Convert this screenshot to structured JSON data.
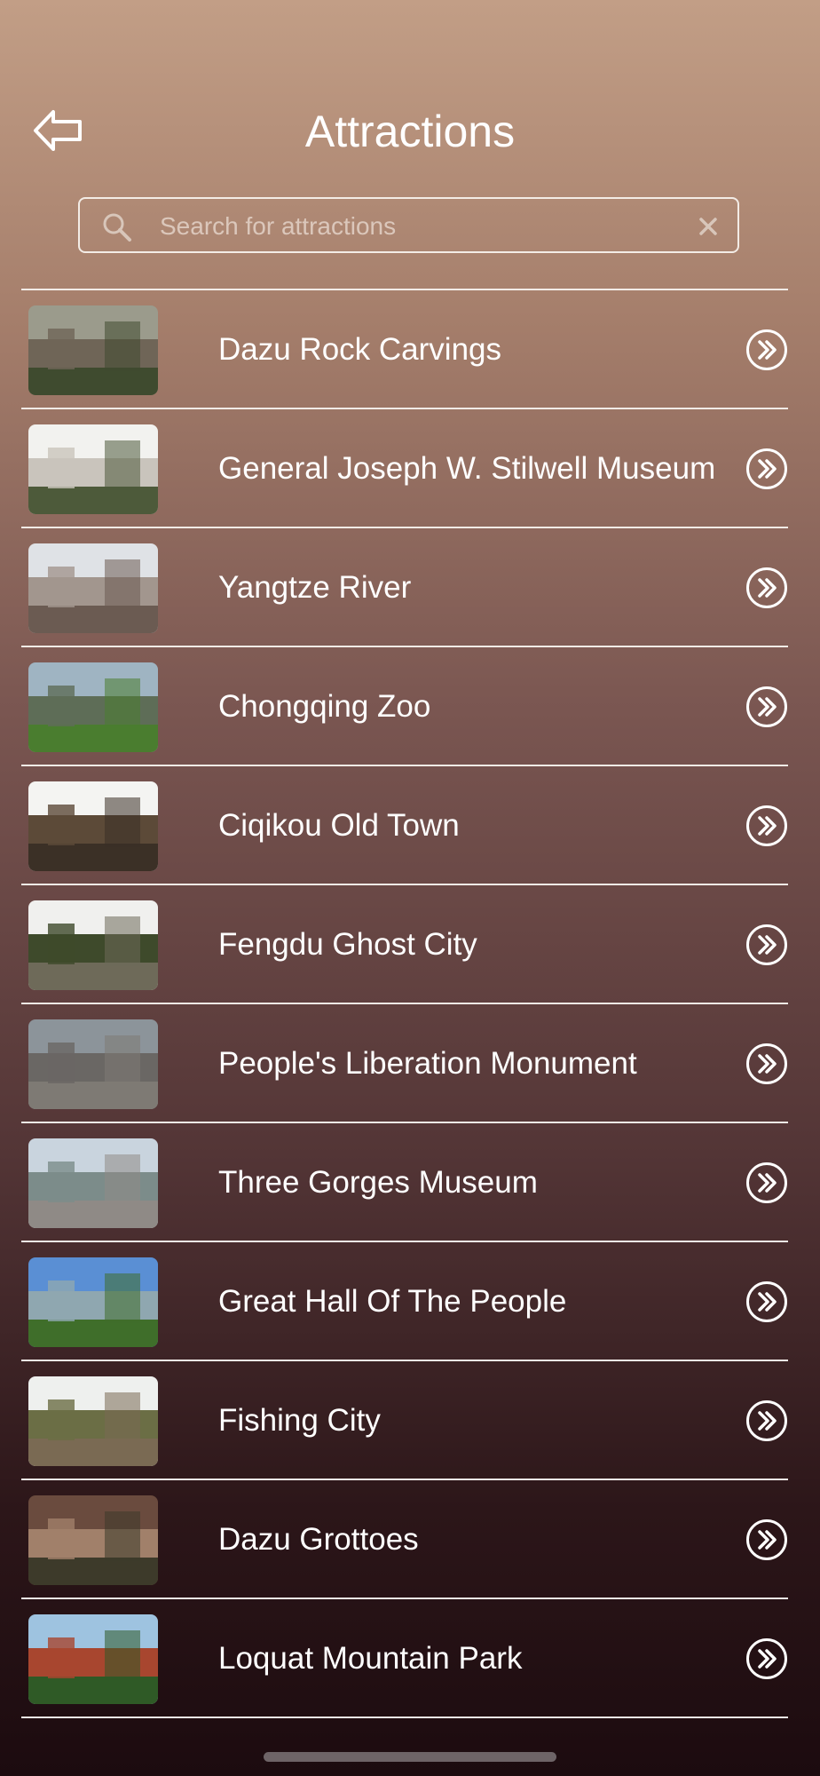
{
  "header": {
    "title": "Attractions",
    "back_icon": "arrow-left-icon"
  },
  "search": {
    "placeholder": "Search for attractions",
    "value": "",
    "icon": "search-icon",
    "clear_icon": "close-icon"
  },
  "attractions": [
    {
      "name": "Dazu Rock Carvings",
      "thumb": "dazu-rock-carvings-thumbnail",
      "theme": [
        "#9b9b8c",
        "#6f6557",
        "#3f4b2f"
      ]
    },
    {
      "name": "General Joseph W. Stilwell Museum",
      "thumb": "stilwell-museum-thumbnail",
      "theme": [
        "#f2f2ef",
        "#c9c4bc",
        "#4d5a3a"
      ]
    },
    {
      "name": "Yangtze River",
      "thumb": "yangtze-river-thumbnail",
      "theme": [
        "#dfe2e6",
        "#a2968e",
        "#6b5b52"
      ]
    },
    {
      "name": "Chongqing Zoo",
      "thumb": "chongqing-zoo-thumbnail",
      "theme": [
        "#9fb4c2",
        "#5e6d57",
        "#4a7d2f"
      ]
    },
    {
      "name": "Ciqikou Old Town",
      "thumb": "ciqikou-old-town-thumbnail",
      "theme": [
        "#f4f4f2",
        "#5c4a38",
        "#3b3026"
      ]
    },
    {
      "name": "Fengdu Ghost City",
      "thumb": "fengdu-ghost-city-thumbnail",
      "theme": [
        "#f0f0ee",
        "#3e4a2b",
        "#6e6a59"
      ]
    },
    {
      "name": "People's Liberation Monument",
      "thumb": "liberation-monument-thumbnail",
      "theme": [
        "#8c949a",
        "#6a6764",
        "#7e7a74"
      ]
    },
    {
      "name": "Three Gorges Museum",
      "thumb": "three-gorges-museum-thumbnail",
      "theme": [
        "#c9d4de",
        "#7c8c8a",
        "#8f8a86"
      ]
    },
    {
      "name": "Great Hall Of The People",
      "thumb": "great-hall-thumbnail",
      "theme": [
        "#5a8fd4",
        "#8fa7b0",
        "#3f6e2a"
      ]
    },
    {
      "name": "Fishing City",
      "thumb": "fishing-city-thumbnail",
      "theme": [
        "#eef0ee",
        "#6b6e45",
        "#7a6a53"
      ]
    },
    {
      "name": "Dazu Grottoes",
      "thumb": "dazu-grottoes-thumbnail",
      "theme": [
        "#6a4b3e",
        "#a1806a",
        "#3d3a2a"
      ]
    },
    {
      "name": "Loquat Mountain Park",
      "thumb": "loquat-mountain-park-thumbnail",
      "theme": [
        "#9ec3e0",
        "#a8462f",
        "#2f5a26"
      ]
    }
  ],
  "row_action_icon": "double-chevron-right-circle-icon",
  "colors": {
    "divider": "#f1ebe6",
    "bg_top": "#c29e86",
    "bg_bottom": "#1c0b0f"
  }
}
